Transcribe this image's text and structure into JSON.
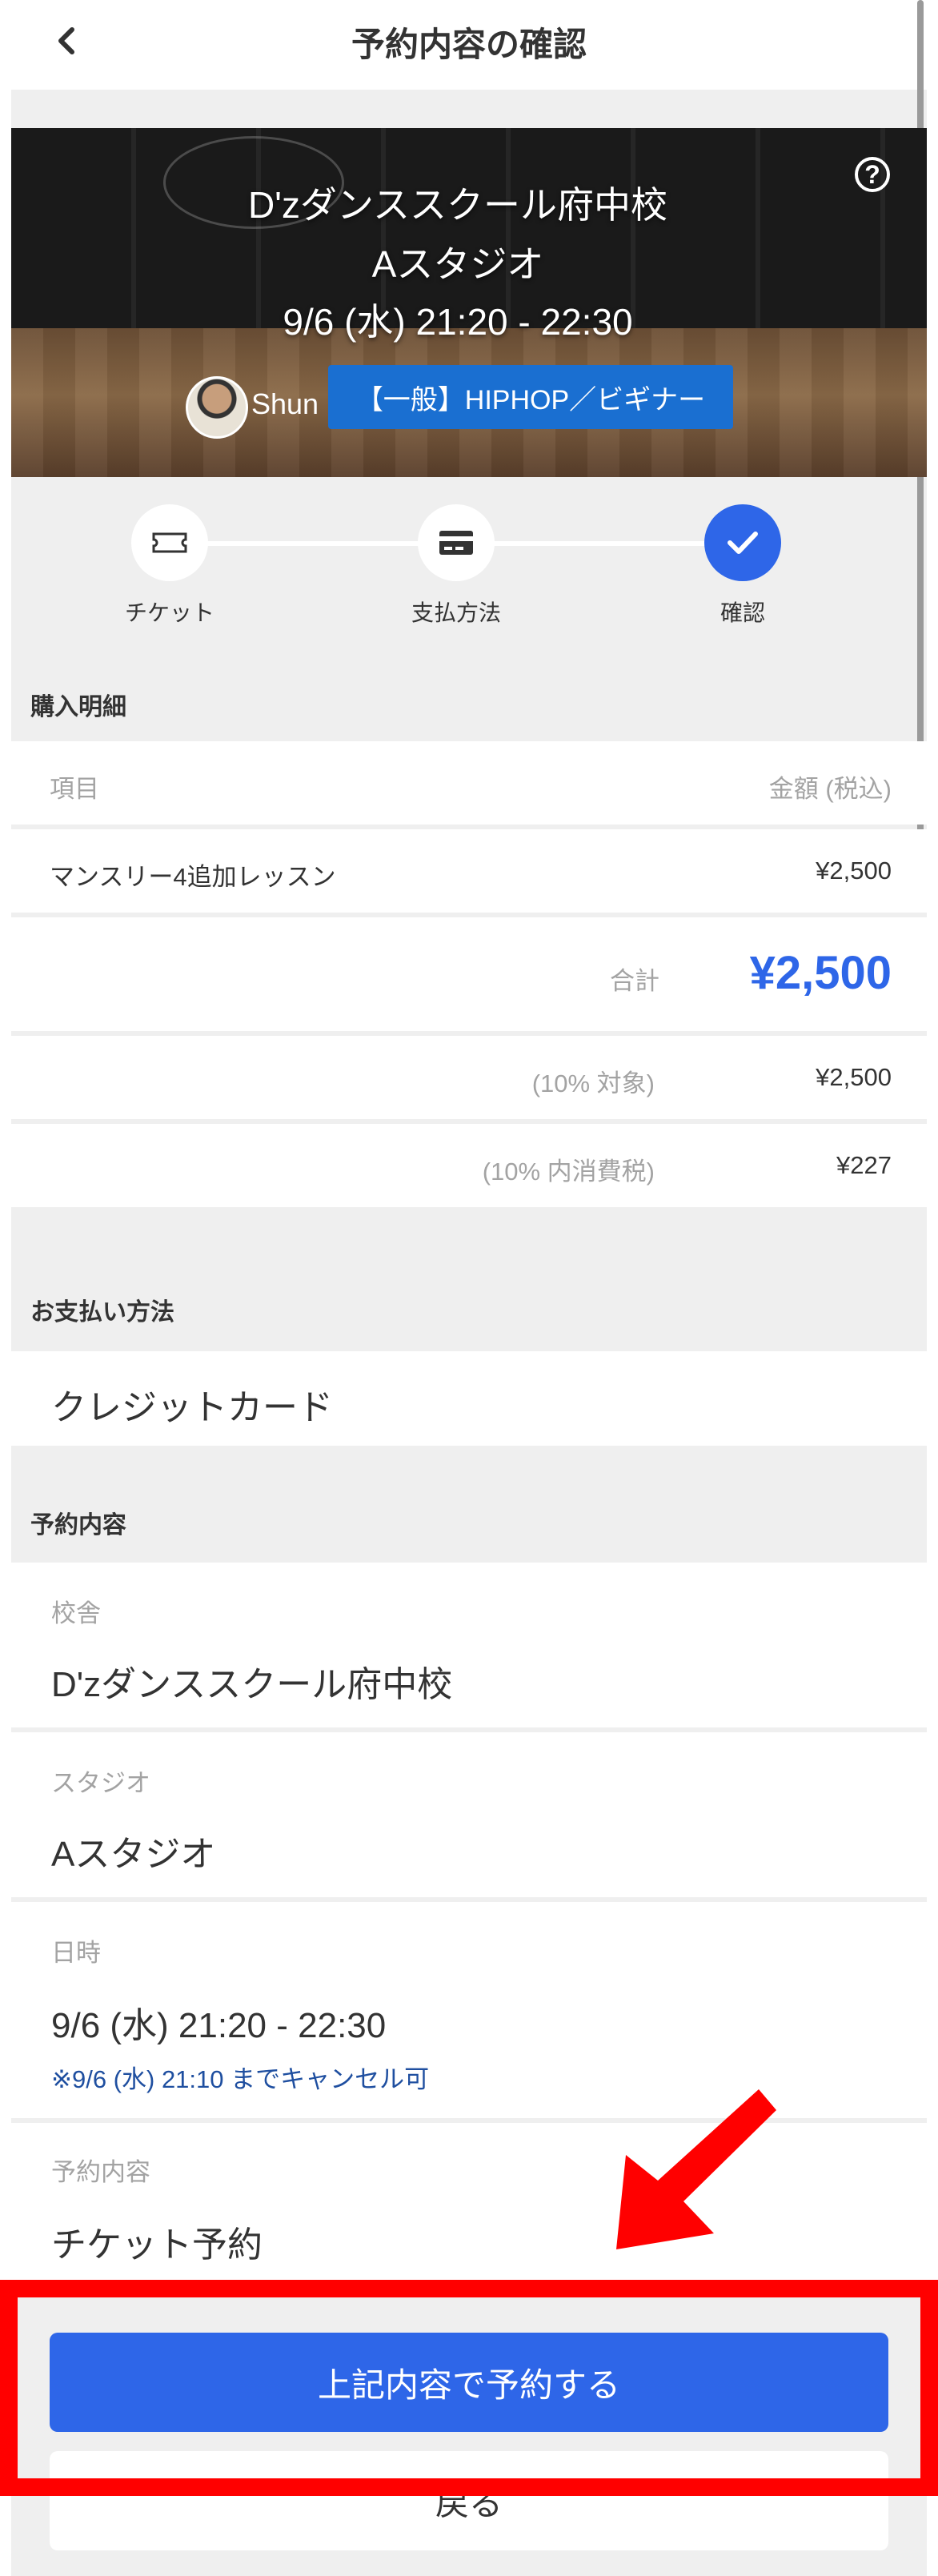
{
  "header": {
    "title": "予約内容の確認",
    "back_icon": "chevron-left-icon"
  },
  "hero": {
    "school": "D'zダンススクール府中校",
    "studio": "Aスタジオ",
    "datetime": "9/6 (水)  21:20 - 22:30",
    "instructor": "Shun",
    "class_name": "【一般】HIPHOP／ビギナー",
    "help_icon": "question-circle-icon"
  },
  "steps": [
    {
      "label": "チケット",
      "icon": "ticket-icon",
      "active": false
    },
    {
      "label": "支払方法",
      "icon": "credit-card-icon",
      "active": false
    },
    {
      "label": "確認",
      "icon": "check-icon",
      "active": true
    }
  ],
  "purchase": {
    "title": "購入明細",
    "col_item": "項目",
    "col_amount": "金額 (税込)",
    "item_name": "マンスリー4追加レッスン",
    "item_price": "¥2,500",
    "total_label": "合計",
    "total_value": "¥2,500",
    "tax_target_label": "(10% 対象)",
    "tax_target_value": "¥2,500",
    "tax_included_label": "(10% 内消費税)",
    "tax_included_value": "¥227"
  },
  "payment": {
    "title": "お支払い方法",
    "method": "クレジットカード"
  },
  "reservation": {
    "title": "予約内容",
    "school_label": "校舎",
    "school_value": "D'zダンススクール府中校",
    "studio_label": "スタジオ",
    "studio_value": "Aスタジオ",
    "datetime_label": "日時",
    "datetime_value": "9/6 (水) 21:20 - 22:30",
    "cancel_note": "※9/6 (水) 21:10 までキャンセル可",
    "type_label": "予約内容",
    "type_value": "チケット予約"
  },
  "actions": {
    "confirm": "上記内容で予約する",
    "back": "戻る"
  },
  "colors": {
    "accent": "#2e66e8",
    "badge": "#1a6fd1",
    "highlight": "#ff0000"
  }
}
